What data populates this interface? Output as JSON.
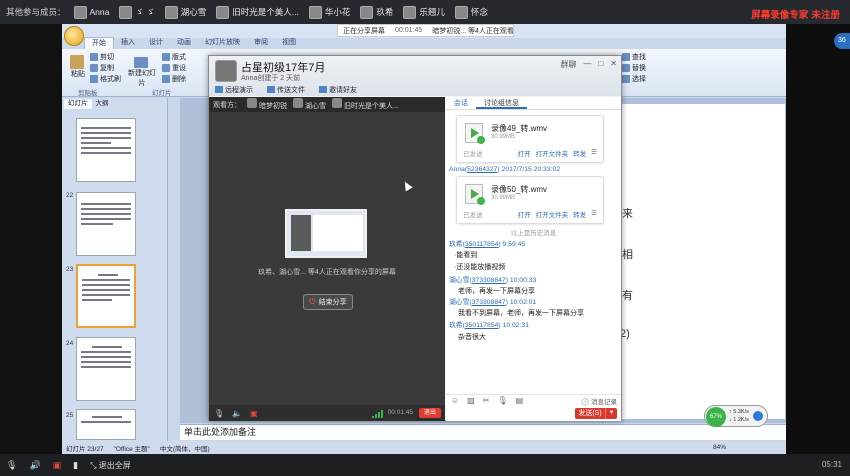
{
  "topbar": {
    "label": "其他参与成员：",
    "participants": [
      "Anna",
      "ゞ ゞ",
      "湖心雪",
      "旧时光是个美人...",
      "华小花",
      "玖希",
      "乐翘儿",
      "怀念"
    ],
    "watermark": "屏幕录像专家 未注册"
  },
  "screen_share_bar": {
    "status": "正在分享屏幕",
    "time": "00:01:45",
    "viewers": "暗梦初锐... 等4人正在观看"
  },
  "ppt": {
    "ribbon_tabs": [
      "开始",
      "插入",
      "设计",
      "动画",
      "幻灯片放映",
      "审阅",
      "视图"
    ],
    "clipboard": {
      "paste": "粘贴",
      "cut": "剪切",
      "copy": "复制",
      "format": "格式刷",
      "label": "剪贴板"
    },
    "slides_group": {
      "new_slide": "新建幻灯片",
      "layout": "版式",
      "reset": "重设",
      "delete": "删除",
      "label": "幻灯片"
    },
    "editing": {
      "find": "查找",
      "replace": "替换",
      "select": "选择"
    },
    "panel_tabs": [
      "幻灯片",
      "大纲"
    ],
    "slide_numbers": [
      "22",
      "23",
      "24",
      "25"
    ],
    "slide_text": [
      "来",
      "相",
      "有",
      "2)"
    ],
    "notes_placeholder": "单击此处添加备注",
    "status": {
      "slide": "幻灯片 23/27",
      "theme": "\"Office 主题\"",
      "lang": "中文(简体，中国)",
      "zoom": "84%"
    }
  },
  "qq": {
    "title": "占星初级17年7月",
    "subtitle": "Anna创建于 2 天前",
    "window_controls": [
      "群聊",
      "—",
      "□",
      "✕"
    ],
    "toolbar": [
      "远程演示",
      "传送文件",
      "邀请好友"
    ],
    "viewer": {
      "label": "观看方：",
      "viewers": [
        "暗梦初锐",
        "湖心雪",
        "旧时光是个美人..."
      ],
      "message": "玖希、湖心雪... 等4人正在观看你分享的屏幕",
      "exit_button": "结束分享",
      "time": "00:01:45",
      "leave": "退出"
    },
    "chat": {
      "tabs": [
        "会话",
        "讨论组信息"
      ],
      "files": [
        {
          "name": "录像49_转.wmv",
          "size": "30.99MB",
          "status": "已发送",
          "actions": [
            "打开",
            "打开文件夹",
            "转发"
          ]
        },
        {
          "name": "录像50_转.wmv",
          "size": "30.99MB",
          "status": "已发送",
          "actions": [
            "打开",
            "打开文件夹",
            "转发"
          ]
        }
      ],
      "file2_head": {
        "name": "Anna",
        "id": "52364327",
        "time": "2017/7/15 20:33:02"
      },
      "separator": "以上是历史消息",
      "messages": [
        {
          "name": "玖希",
          "id": "350117854",
          "time": "9:59:45",
          "lines": [
            "·能看到",
            "·还没能放播视频"
          ]
        },
        {
          "name": "湖心雪",
          "id": "373308847",
          "time": "10:00:33",
          "lines": [
            "老师，再发一下屏幕分享"
          ]
        },
        {
          "name": "湖心雪",
          "id": "373308847",
          "time": "10:02:01",
          "lines": [
            "我看不到屏幕，老师，再发一下屏幕分享"
          ]
        },
        {
          "name": "玖希",
          "id": "350117854",
          "time": "10:02:31",
          "lines": [
            "杂音很大"
          ]
        }
      ],
      "history": "消息记录",
      "send": "发送(S)"
    }
  },
  "net_widget": {
    "percent": "67%",
    "up": "5.3K/s",
    "down": "1.2K/s"
  },
  "side_badge": "36",
  "bottombar": {
    "exit_fullscreen": "退出全屏",
    "clock": "05:31"
  }
}
